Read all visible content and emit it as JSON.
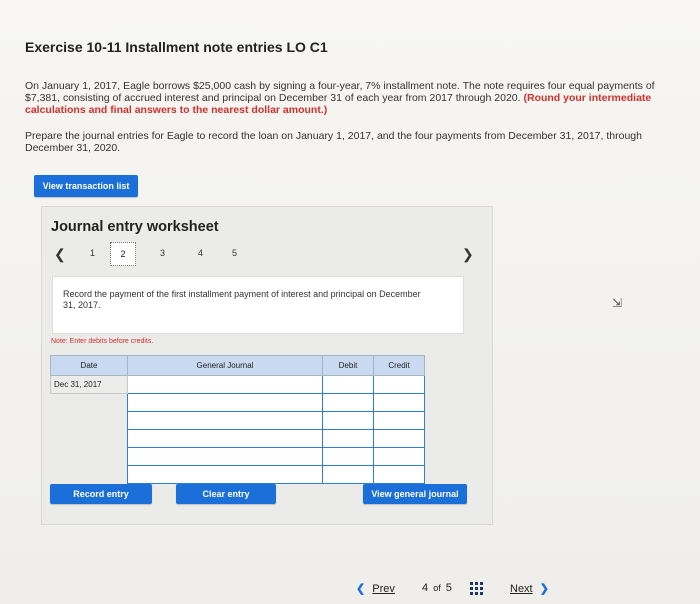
{
  "header": {
    "title": "Exercise 10-11 Installment note entries LO C1"
  },
  "problem": {
    "text_main": "On January 1, 2017, Eagle borrows $25,000 cash by signing a four-year, 7% installment note. The note requires four equal payments of $7,381, consisting of accrued interest and principal on December 31 of each year from 2017 through 2020.",
    "text_red": "(Round your intermediate calculations and final answers to the nearest dollar amount.)",
    "task": "Prepare the journal entries for Eagle to record the loan on January 1, 2017, and the four payments from December 31, 2017, through December 31, 2020."
  },
  "buttons": {
    "view_transaction_list": "View transaction list",
    "record_entry": "Record entry",
    "clear_entry": "Clear entry",
    "view_general_journal": "View general journal"
  },
  "worksheet": {
    "title": "Journal entry worksheet",
    "pages": [
      "1",
      "2",
      "3",
      "4",
      "5"
    ],
    "active_page": "2",
    "instruction": "Record the payment of the first installment payment of interest and principal on December 31, 2017.",
    "note": "Note: Enter debits before credits.",
    "columns": [
      "Date",
      "General Journal",
      "Debit",
      "Credit"
    ],
    "date_value": "Dec 31, 2017"
  },
  "footer": {
    "prev": "Prev",
    "position": "4",
    "of": "of",
    "total": "5",
    "next": "Next"
  },
  "colors": {
    "button_blue": "#1a6fd8",
    "accent_red": "#d0312d",
    "header_fill": "#c9daf0"
  }
}
